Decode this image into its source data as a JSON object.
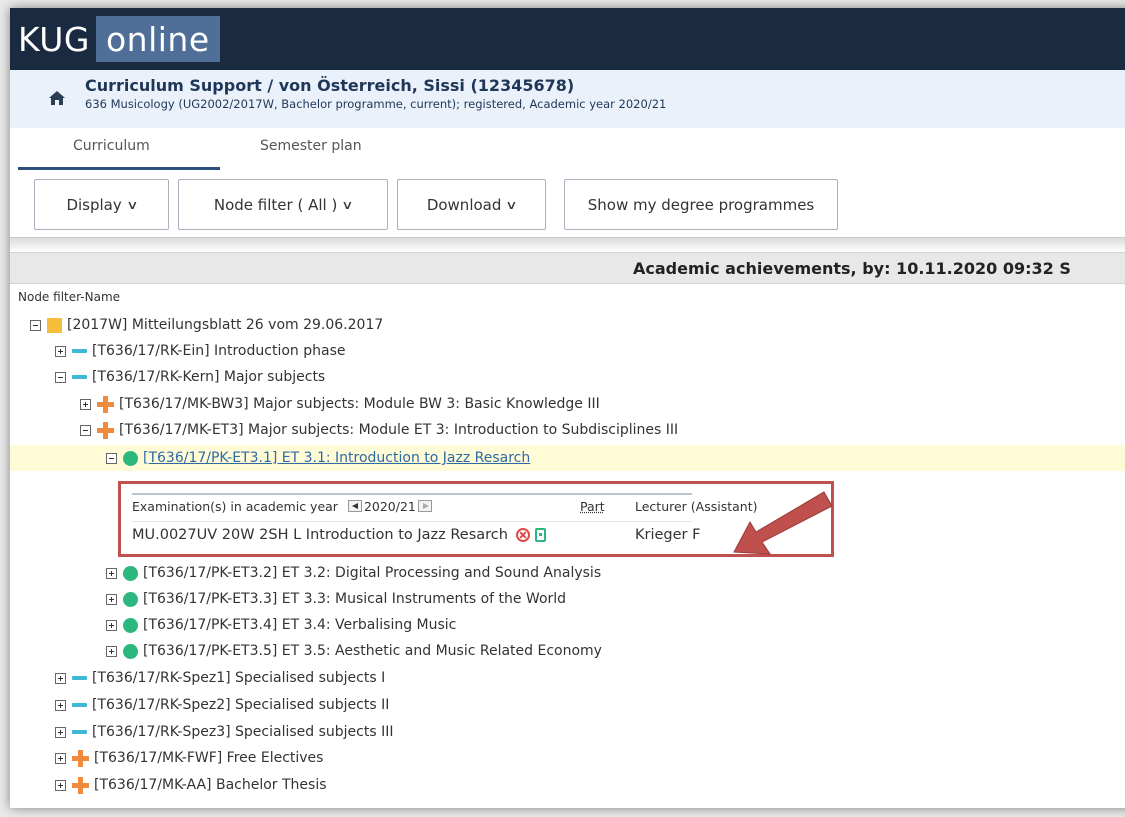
{
  "logo": {
    "part1": "KUG",
    "part2": "online"
  },
  "breadcrumb": {
    "title": "Curriculum Support  / von Österreich, Sissi (12345678)",
    "subtitle": "636 Musicology (UG2002/2017W, Bachelor programme, current); registered, Academic year 2020/21"
  },
  "tabs": [
    {
      "label": "Curriculum",
      "active": true
    },
    {
      "label": "Semester plan",
      "active": false
    }
  ],
  "toolbar": {
    "display": "Display",
    "node_filter": "Node filter ( All )",
    "download": "Download",
    "show_programmes": "Show my degree programmes"
  },
  "achievements_header": "Academic achievements, by: 10.11.2020 09:32 S",
  "column_header": "Node filter-Name",
  "tree": [
    {
      "label": "[2017W] Mitteilungsblatt 26 vom 29.06.2017",
      "icon": "square-folder-icon",
      "expanded": true
    },
    {
      "label": "[T636/17/RK-Ein] Introduction phase",
      "icon": "dash-icon",
      "expanded": false
    },
    {
      "label": "[T636/17/RK-Kern] Major subjects",
      "icon": "dash-icon",
      "expanded": true
    },
    {
      "label": "[T636/17/MK-BW3] Major subjects: Module BW 3: Basic Knowledge III",
      "icon": "plus-module-icon",
      "expanded": false
    },
    {
      "label": "[T636/17/MK-ET3] Major subjects: Module ET 3: Introduction to Subdisciplines III",
      "icon": "plus-module-icon",
      "expanded": true
    },
    {
      "label": "[T636/17/PK-ET3.1] ET 3.1: Introduction to Jazz Resarch",
      "icon": "circle-icon",
      "expanded": true
    },
    {
      "label": "[T636/17/PK-ET3.2] ET 3.2: Digital Processing and Sound Analysis",
      "icon": "circle-icon",
      "expanded": false
    },
    {
      "label": "[T636/17/PK-ET3.3] ET 3.3: Musical Instruments of the World",
      "icon": "circle-icon",
      "expanded": false
    },
    {
      "label": "[T636/17/PK-ET3.4] ET 3.4: Verbalising Music",
      "icon": "circle-icon",
      "expanded": false
    },
    {
      "label": "[T636/17/PK-ET3.5] ET 3.5: Aesthetic and Music Related Economy",
      "icon": "circle-icon",
      "expanded": false
    },
    {
      "label": "[T636/17/RK-Spez1] Specialised subjects I",
      "icon": "dash-icon",
      "expanded": false
    },
    {
      "label": "[T636/17/RK-Spez2] Specialised subjects II",
      "icon": "dash-icon",
      "expanded": false
    },
    {
      "label": "[T636/17/RK-Spez3] Specialised subjects III",
      "icon": "dash-icon",
      "expanded": false
    },
    {
      "label": "[T636/17/MK-FWF] Free Electives",
      "icon": "plus-module-icon",
      "expanded": false
    },
    {
      "label": "[T636/17/MK-AA] Bachelor Thesis",
      "icon": "plus-module-icon",
      "expanded": false
    }
  ],
  "exam": {
    "header_label": "Examination(s) in academic year",
    "year": "2020/21",
    "part_label": "Part",
    "lecturer_label": "Lecturer (Assistant)",
    "course": "MU.0027UV 20W 2SH L Introduction to Jazz Resarch",
    "lecturer": "Krieger F"
  },
  "colors": {
    "header_bg": "#1a2a40",
    "annotation_red": "#c0504d",
    "highlight": "#fffbd6"
  }
}
